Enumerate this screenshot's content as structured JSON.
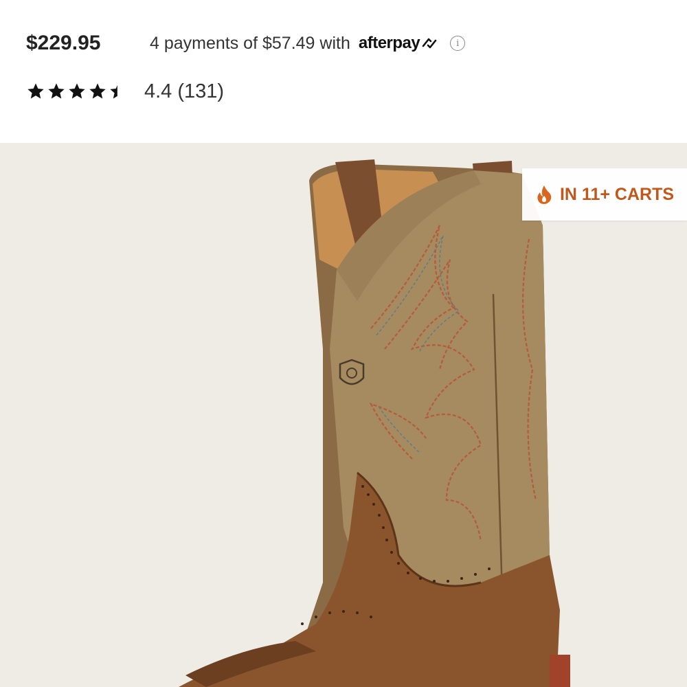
{
  "product": {
    "price": "$229.95",
    "installments": {
      "text": "4 payments of $57.49 with",
      "provider": "afterpay"
    },
    "rating": {
      "stars": 4.4,
      "text": "4.4 (131)"
    }
  },
  "badge": {
    "label": "IN 11+ CARTS",
    "icon": "flame-icon",
    "color": "#c0581b"
  },
  "colors": {
    "hero_background": "#efece6",
    "badge_text": "#c0581b"
  }
}
